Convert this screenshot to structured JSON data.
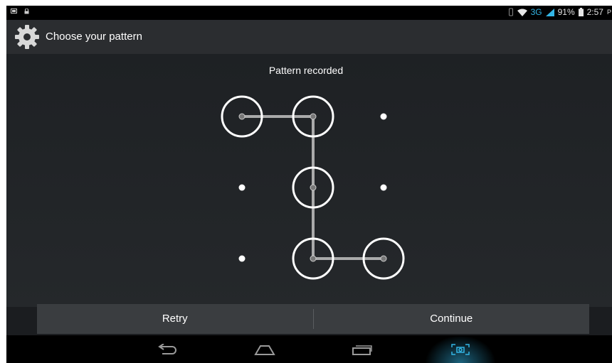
{
  "status_bar": {
    "network": "3G",
    "battery": "91%",
    "time": "2:57",
    "time_suffix": "P",
    "icons": [
      "screenshot-icon",
      "lock-icon",
      "vibrate-icon",
      "wifi-icon",
      "signal-icon",
      "battery-icon"
    ]
  },
  "action_bar": {
    "title": "Choose your pattern",
    "icon": "settings-gear-icon"
  },
  "pattern": {
    "header": "Pattern recorded",
    "path": [
      1,
      2,
      5,
      8,
      9
    ],
    "line_color": "#aaaaaa",
    "ring_color": "#ffffff"
  },
  "buttons": {
    "retry": "Retry",
    "continue": "Continue"
  },
  "nav_bar": {
    "icons": [
      "back-icon",
      "home-icon",
      "recent-apps-icon",
      "screenshot-capture-icon"
    ],
    "accent": "#33b5e5"
  }
}
